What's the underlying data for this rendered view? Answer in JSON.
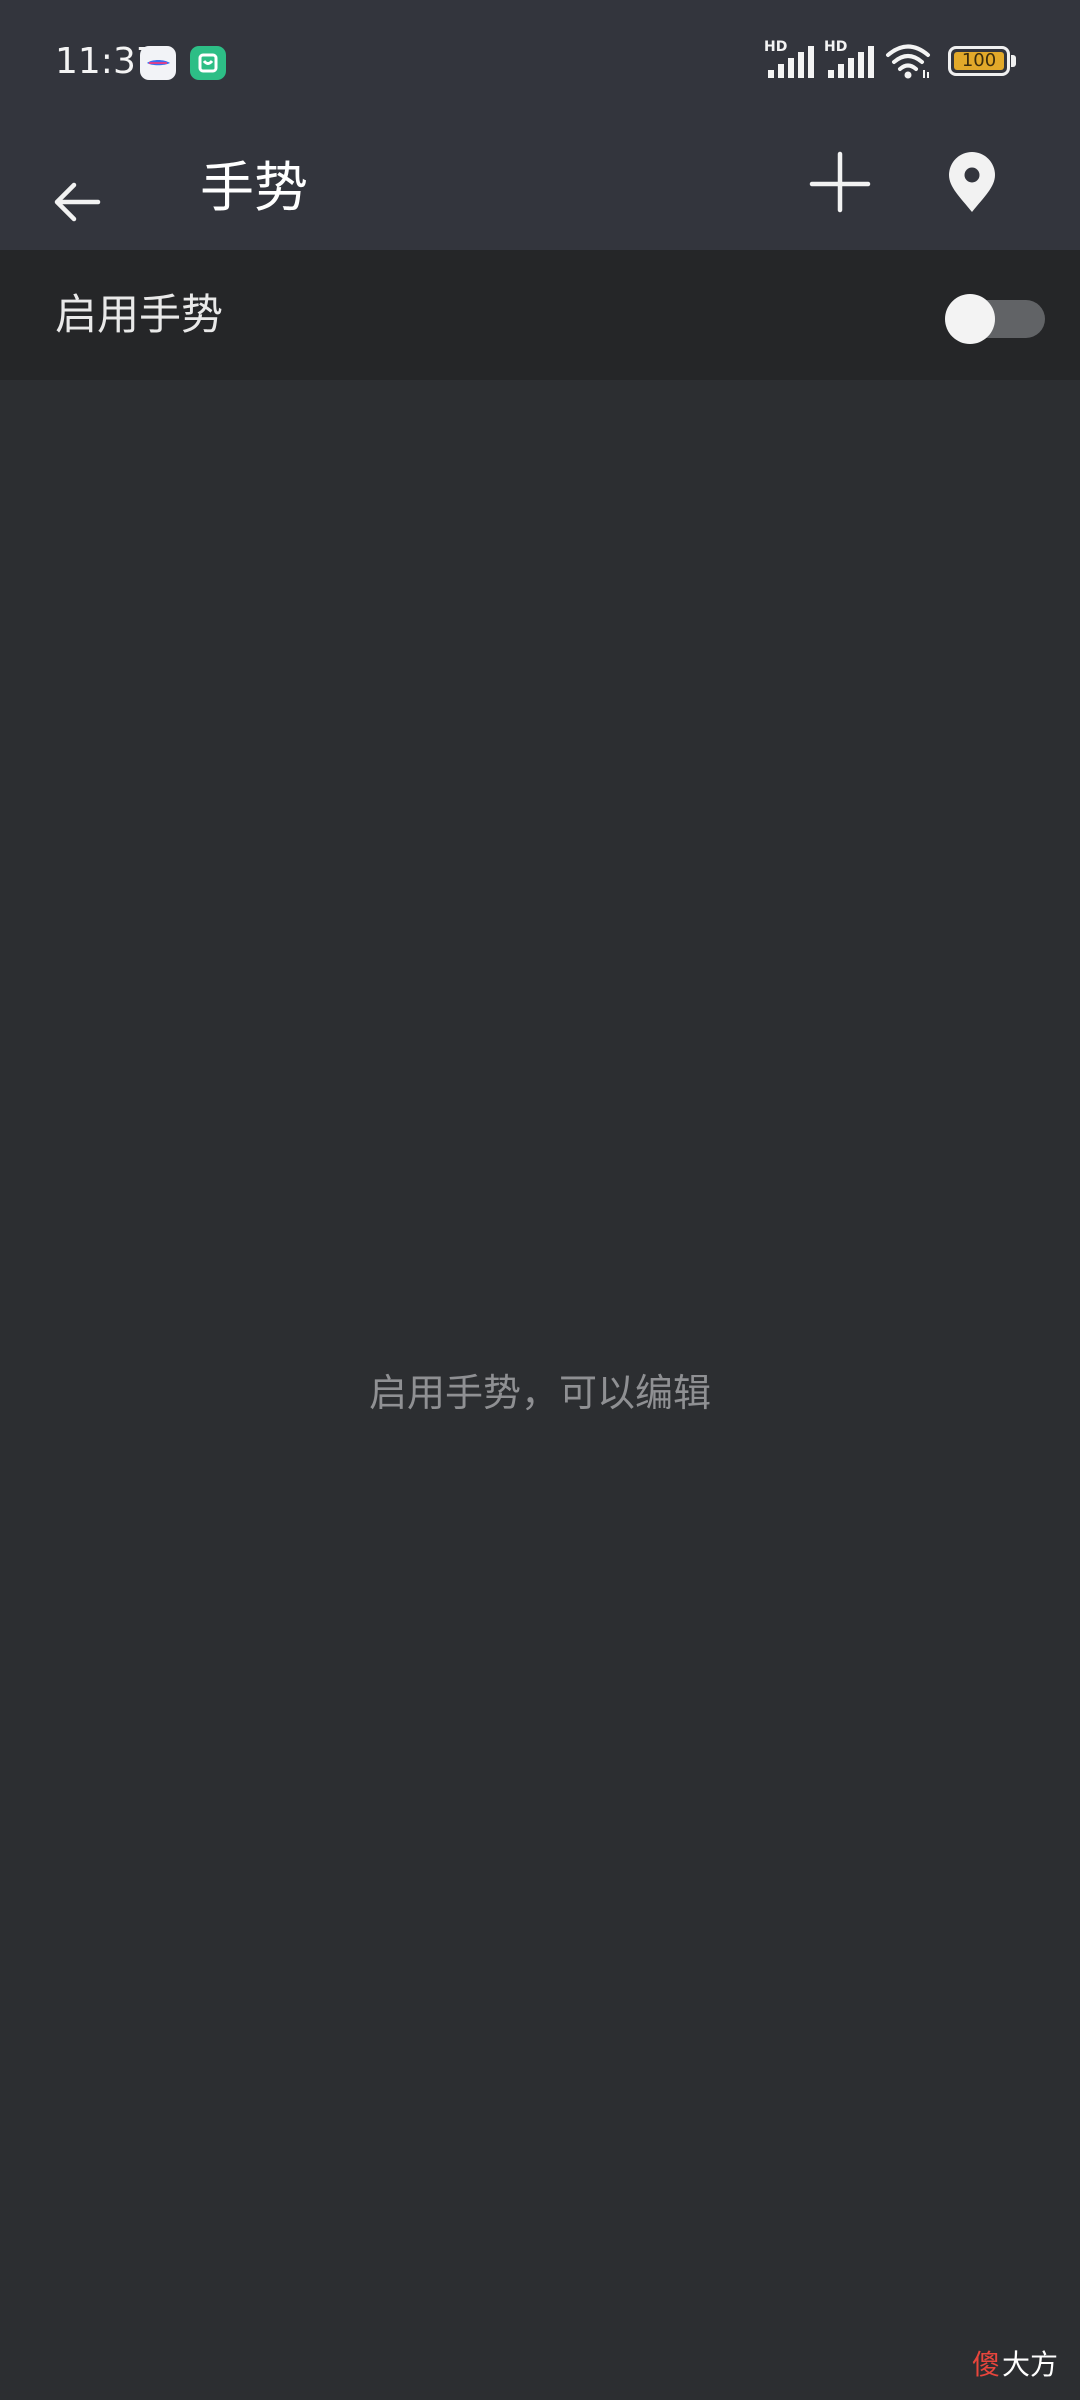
{
  "status_bar": {
    "time": "11:37",
    "notification_icons": [
      "ink-app-icon",
      "mi-home-app-icon"
    ],
    "signal_1_label": "HD",
    "signal_2_label": "HD",
    "battery_level": "100"
  },
  "app_bar": {
    "title": "手势",
    "back_icon": "arrow-left-icon",
    "add_icon": "plus-icon",
    "location_icon": "location-pin-icon"
  },
  "settings": {
    "enable_label": "启用手势",
    "enable_toggle_on": false
  },
  "empty_state": {
    "hint": "启用手势，可以编辑"
  },
  "watermark": {
    "text": "傻大方"
  },
  "colors": {
    "app_bar_bg": "#33353d",
    "row_bg": "#252628",
    "page_bg": "#2c2e31",
    "hint_text": "#8f9093",
    "battery_fill": "#e2a92a"
  }
}
